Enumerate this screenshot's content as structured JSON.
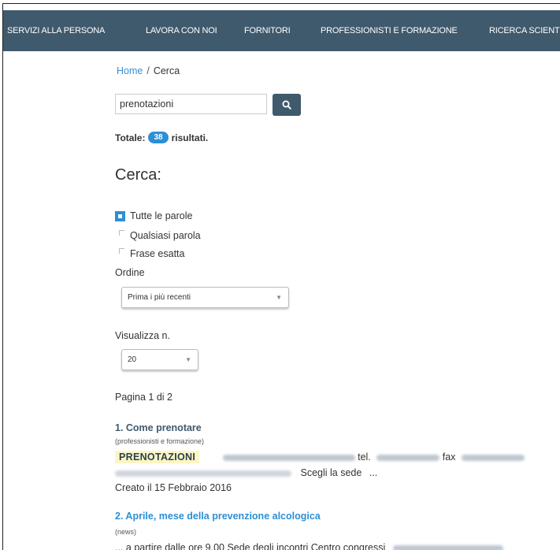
{
  "nav": {
    "items": [
      "SERVIZI ALLA PERSONA",
      "LAVORA CON NOI",
      "FORNITORI",
      "PROFESSIONISTI E FORMAZIONE",
      "RICERCA SCIENT"
    ]
  },
  "breadcrumb": {
    "home": "Home",
    "separator": "/",
    "current": "Cerca"
  },
  "search": {
    "value": "prenotazioni",
    "button_icon": "search-icon"
  },
  "totals": {
    "prefix": "Totale:",
    "count": "38",
    "suffix": "risultati."
  },
  "form": {
    "heading": "Cerca:",
    "match_options": [
      {
        "label": "Tutte le parole",
        "selected": true
      },
      {
        "label": "Qualsiasi parola",
        "selected": false
      },
      {
        "label": "Frase esatta",
        "selected": false
      }
    ],
    "order_label": "Ordine",
    "order_value": "Prima i più recenti",
    "limit_label": "Visualizza n.",
    "limit_value": "20"
  },
  "pagination": {
    "text": "Pagina 1 di 2"
  },
  "results": [
    {
      "title": "1. Come prenotare",
      "category": "(professionisti e formazione)",
      "highlight": "PRENOTAZIONI",
      "tel_label": "tel.",
      "fax_label": "fax",
      "sede_text": "Scegli la sede",
      "ellipsis": "...",
      "created": "Creato il 15 Febbraio 2016"
    },
    {
      "title": "2. Aprile, mese della prevenzione alcologica",
      "category": "(news)",
      "snippet": "... a partire dalle ore 9.00 Sede degli incontri Centro congressi"
    }
  ],
  "colors": {
    "nav_bg": "#3f5a6d",
    "accent": "#2c8fd6",
    "highlight_bg": "#fbf6c4"
  }
}
